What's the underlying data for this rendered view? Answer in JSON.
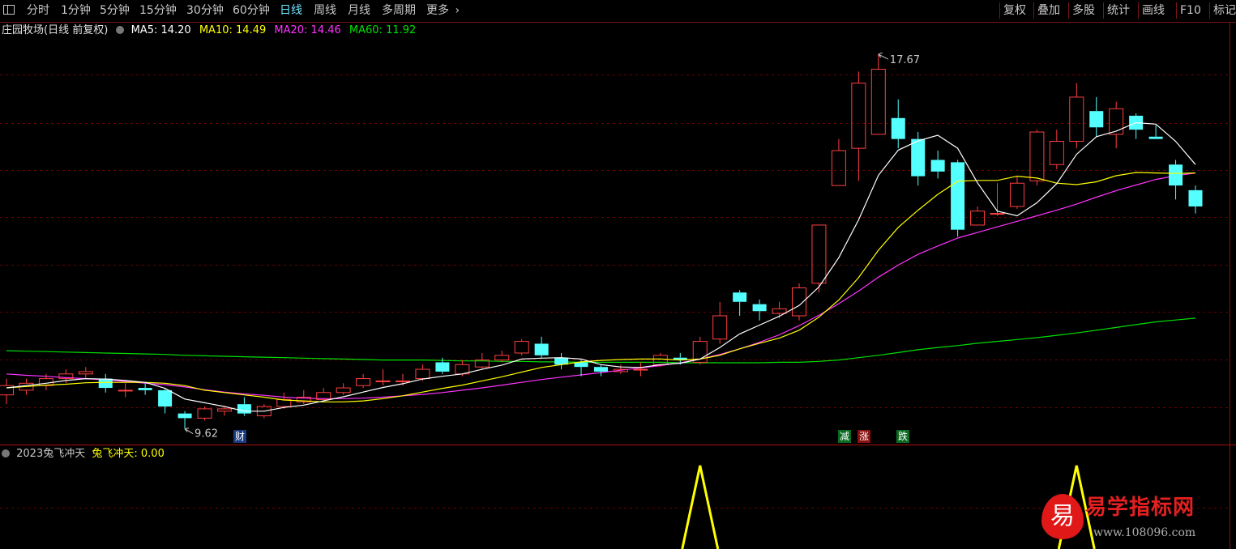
{
  "toolbar": {
    "app_icon": "window-icon",
    "periods": [
      "分时",
      "1分钟",
      "5分钟",
      "15分钟",
      "30分钟",
      "60分钟",
      "日线",
      "周线",
      "月线",
      "多周期",
      "更多"
    ],
    "active_period": "日线",
    "more_icon": "chevron-right-icon",
    "right_buttons": [
      "复权",
      "叠加",
      "多股",
      "统计",
      "画线",
      "F10",
      "标记"
    ]
  },
  "main_panel": {
    "stock_name": "庄园牧场",
    "chart_mode": "(日线 前复权)",
    "ma": [
      {
        "label": "MA5: ",
        "value": "14.20",
        "color": "#ffffff"
      },
      {
        "label": "MA10: ",
        "value": "14.49",
        "color": "#ffff00"
      },
      {
        "label": "MA20: ",
        "value": "14.46",
        "color": "#ff33ff"
      },
      {
        "label": "MA60: ",
        "value": "11.92",
        "color": "#00e000"
      }
    ],
    "high_label": "17.67",
    "low_label": "9.62",
    "event_tags": [
      {
        "text": "财",
        "color": "#3070d0"
      },
      {
        "text": "减",
        "color": "#00a030"
      },
      {
        "text": "涨",
        "color": "#d02020"
      },
      {
        "text": "跌",
        "color": "#00a030"
      }
    ]
  },
  "indicator_panel": {
    "name": "2023兔飞冲天",
    "value_label": "兔飞冲天: ",
    "value": "0.00"
  },
  "watermark": {
    "badge": "易",
    "title": "易学指标网",
    "url": "www.108096.com"
  },
  "colors": {
    "up": "#ff4040",
    "down": "#54ffff",
    "ma5": "#ffffff",
    "ma10": "#ffff00",
    "ma20": "#ff33ff",
    "ma60": "#00e000",
    "signal": "#ffff00",
    "grid": "#6a0000"
  },
  "chart_data": {
    "type": "candlestick",
    "series_fields": [
      "open",
      "close",
      "high",
      "low"
    ],
    "candles": [
      [
        10.35,
        10.55,
        10.7,
        10.15
      ],
      [
        10.45,
        10.6,
        10.7,
        10.35
      ],
      [
        10.55,
        10.7,
        10.8,
        10.45
      ],
      [
        10.7,
        10.8,
        10.9,
        10.6
      ],
      [
        10.8,
        10.85,
        10.95,
        10.7
      ],
      [
        10.7,
        10.5,
        10.8,
        10.4
      ],
      [
        10.45,
        10.45,
        10.6,
        10.3
      ],
      [
        10.5,
        10.45,
        10.6,
        10.35
      ],
      [
        10.45,
        10.1,
        10.5,
        9.95
      ],
      [
        9.95,
        9.85,
        10.0,
        9.62
      ],
      [
        9.85,
        10.05,
        10.1,
        9.8
      ],
      [
        10.0,
        10.05,
        10.1,
        9.9
      ],
      [
        10.15,
        9.95,
        10.3,
        9.9
      ],
      [
        9.9,
        10.1,
        10.15,
        9.85
      ],
      [
        10.1,
        10.25,
        10.4,
        10.05
      ],
      [
        10.2,
        10.3,
        10.45,
        10.15
      ],
      [
        10.25,
        10.4,
        10.5,
        10.2
      ],
      [
        10.4,
        10.5,
        10.6,
        10.35
      ],
      [
        10.55,
        10.7,
        10.8,
        10.5
      ],
      [
        10.65,
        10.65,
        10.9,
        10.55
      ],
      [
        10.65,
        10.65,
        10.8,
        10.55
      ],
      [
        10.7,
        10.9,
        11.0,
        10.65
      ],
      [
        11.05,
        10.85,
        11.15,
        10.8
      ],
      [
        10.8,
        11.0,
        11.1,
        10.75
      ],
      [
        10.95,
        11.1,
        11.25,
        10.9
      ],
      [
        11.1,
        11.2,
        11.3,
        11.05
      ],
      [
        11.25,
        11.5,
        11.55,
        11.2
      ],
      [
        11.45,
        11.2,
        11.6,
        11.15
      ],
      [
        11.15,
        11.0,
        11.25,
        10.9
      ],
      [
        11.05,
        10.95,
        11.1,
        10.75
      ],
      [
        10.95,
        10.85,
        11.0,
        10.75
      ],
      [
        10.85,
        10.9,
        11.0,
        10.8
      ],
      [
        10.9,
        10.9,
        11.05,
        10.75
      ],
      [
        11.0,
        11.2,
        11.25,
        10.95
      ],
      [
        11.15,
        11.1,
        11.25,
        11.0
      ],
      [
        11.05,
        11.5,
        11.6,
        11.0
      ],
      [
        11.55,
        12.05,
        12.35,
        11.45
      ],
      [
        12.55,
        12.35,
        12.6,
        12.05
      ],
      [
        12.3,
        12.15,
        12.4,
        11.95
      ],
      [
        12.1,
        12.2,
        12.35,
        12.0
      ],
      [
        12.05,
        12.65,
        12.75,
        11.95
      ],
      [
        12.75,
        14.0,
        14.0,
        12.55
      ],
      [
        14.85,
        15.6,
        15.85,
        14.85
      ],
      [
        15.65,
        17.05,
        17.3,
        14.95
      ],
      [
        15.95,
        17.35,
        17.67,
        15.95
      ],
      [
        16.3,
        15.85,
        16.7,
        15.65
      ],
      [
        15.85,
        15.05,
        16.0,
        14.85
      ],
      [
        15.4,
        15.15,
        15.6,
        15.0
      ],
      [
        15.35,
        13.9,
        15.4,
        13.75
      ],
      [
        14.0,
        14.3,
        14.4,
        14.0
      ],
      [
        14.25,
        14.25,
        14.9,
        14.2
      ],
      [
        14.4,
        14.9,
        15.05,
        14.35
      ],
      [
        14.95,
        16.0,
        16.05,
        14.85
      ],
      [
        15.3,
        15.8,
        16.05,
        15.2
      ],
      [
        15.8,
        16.75,
        17.05,
        15.65
      ],
      [
        16.45,
        16.1,
        16.75,
        15.9
      ],
      [
        15.95,
        16.5,
        16.65,
        15.65
      ],
      [
        16.35,
        16.05,
        16.4,
        15.85
      ],
      [
        15.9,
        15.85,
        16.15,
        15.85
      ],
      [
        15.3,
        14.85,
        15.4,
        14.55
      ],
      [
        14.75,
        14.4,
        14.85,
        14.25
      ]
    ],
    "ma5": [
      10.5,
      10.55,
      10.6,
      10.66,
      10.7,
      10.69,
      10.66,
      10.62,
      10.49,
      10.26,
      10.18,
      10.1,
      10.0,
      10.0,
      10.08,
      10.13,
      10.22,
      10.31,
      10.41,
      10.51,
      10.59,
      10.69,
      10.75,
      10.8,
      10.9,
      10.99,
      11.12,
      11.14,
      11.15,
      11.12,
      11.0,
      10.95,
      10.94,
      11.0,
      11.03,
      11.12,
      11.37,
      11.66,
      11.85,
      12.04,
      12.27,
      12.67,
      13.3,
      14.11,
      15.07,
      15.61,
      15.81,
      15.93,
      15.65,
      14.91,
      14.3,
      14.2,
      14.48,
      14.89,
      15.52,
      15.9,
      16.02,
      16.2,
      16.17,
      15.8,
      15.3
    ],
    "ma10": [
      10.5,
      10.53,
      10.56,
      10.58,
      10.61,
      10.62,
      10.62,
      10.62,
      10.6,
      10.55,
      10.45,
      10.4,
      10.35,
      10.3,
      10.24,
      10.22,
      10.2,
      10.2,
      10.22,
      10.27,
      10.33,
      10.41,
      10.49,
      10.56,
      10.65,
      10.74,
      10.84,
      10.94,
      11.0,
      11.06,
      11.09,
      11.11,
      11.12,
      11.12,
      11.1,
      11.12,
      11.2,
      11.34,
      11.46,
      11.57,
      11.74,
      12.02,
      12.39,
      12.87,
      13.46,
      13.95,
      14.32,
      14.66,
      14.94,
      14.96,
      14.96,
      15.05,
      15.01,
      14.9,
      14.87,
      14.93,
      15.06,
      15.13,
      15.12,
      15.11,
      15.12
    ],
    "ma20": [
      10.8,
      10.77,
      10.75,
      10.72,
      10.7,
      10.67,
      10.64,
      10.6,
      10.57,
      10.52,
      10.46,
      10.41,
      10.37,
      10.34,
      10.3,
      10.28,
      10.27,
      10.27,
      10.28,
      10.3,
      10.33,
      10.36,
      10.4,
      10.45,
      10.5,
      10.56,
      10.62,
      10.68,
      10.73,
      10.78,
      10.83,
      10.88,
      10.93,
      10.98,
      11.04,
      11.12,
      11.22,
      11.34,
      11.48,
      11.64,
      11.84,
      12.06,
      12.31,
      12.58,
      12.88,
      13.14,
      13.37,
      13.55,
      13.72,
      13.84,
      13.96,
      14.08,
      14.2,
      14.32,
      14.45,
      14.6,
      14.74,
      14.86,
      14.98,
      15.06,
      15.12
    ],
    "ma60": [
      11.3,
      11.29,
      11.28,
      11.27,
      11.26,
      11.25,
      11.24,
      11.23,
      11.22,
      11.2,
      11.19,
      11.18,
      11.17,
      11.16,
      11.15,
      11.14,
      11.13,
      11.12,
      11.11,
      11.1,
      11.1,
      11.1,
      11.09,
      11.08,
      11.08,
      11.07,
      11.07,
      11.06,
      11.06,
      11.05,
      11.05,
      11.05,
      11.05,
      11.05,
      11.04,
      11.04,
      11.04,
      11.04,
      11.04,
      11.05,
      11.05,
      11.07,
      11.1,
      11.15,
      11.2,
      11.26,
      11.32,
      11.37,
      11.41,
      11.46,
      11.5,
      11.54,
      11.58,
      11.63,
      11.68,
      11.74,
      11.8,
      11.86,
      11.92,
      11.96,
      12.0
    ],
    "signal_peaks": [
      35,
      54
    ],
    "high": {
      "index": 44,
      "value": 17.67
    },
    "low": {
      "index": 9,
      "value": 9.62
    },
    "y_range": [
      9.3,
      18.35
    ]
  }
}
